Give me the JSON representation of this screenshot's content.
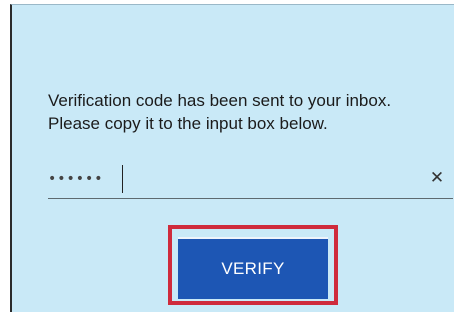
{
  "dialog": {
    "message_line1": "Verification code has been sent to your inbox.",
    "message_line2": "Please copy it to the input box below."
  },
  "code_input": {
    "value": "••••••",
    "clear_icon": "close-icon",
    "clear_glyph": "✕"
  },
  "actions": {
    "verify_label": "VERIFY"
  },
  "colors": {
    "panel_background": "#c9e9f7",
    "button_background": "#1d56b4",
    "highlight_border": "#cf2b3c"
  }
}
